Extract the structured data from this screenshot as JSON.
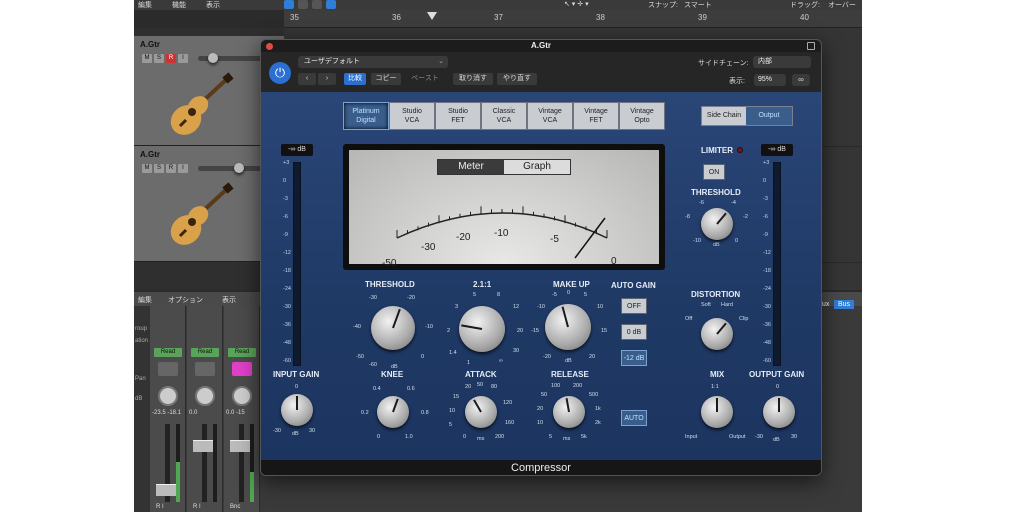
{
  "daw": {
    "top_left": "編集",
    "menu1": "機能",
    "menu2": "表示",
    "snap_label": "スナップ:",
    "snap_value": "スマート",
    "drag_label": "ドラッグ:",
    "drag_value": "オーバーラ",
    "ruler": [
      "35",
      "36",
      "37",
      "38",
      "39",
      "40"
    ],
    "tracks": [
      {
        "name": "A.Gtr",
        "m": "M",
        "s": "S",
        "r": "R",
        "i": "I"
      },
      {
        "name": "A.Gtr",
        "m": "M",
        "s": "S",
        "r": "R",
        "i": "I"
      }
    ],
    "mixer_menu": {
      "edit": "編集",
      "options": "オプション",
      "view": "表示"
    },
    "mixer_side": [
      "roup",
      "ation",
      "Pan",
      "dB"
    ],
    "strips": [
      {
        "read": "Read",
        "val": "-23.5  -18.1",
        "ri": "R I"
      },
      {
        "read": "Read",
        "val": "0.0",
        "ri": "R I"
      },
      {
        "read": "Read",
        "val": "0.0   -15",
        "ri": "Bnc"
      }
    ],
    "bus_labels": [
      "ux",
      "Bus"
    ]
  },
  "plugin": {
    "title": "A.Gtr",
    "preset": "ユーザデフォルト",
    "nav_prev": "‹",
    "nav_next": "›",
    "compare": "比較",
    "copy": "コピー",
    "paste": "ペースト",
    "undo": "取り消す",
    "redo": "やり直す",
    "sidechain_label": "サイドチェーン:",
    "sidechain_value": "内部",
    "zoom_label": "表示:",
    "zoom_value": "95%",
    "footer": "Compressor",
    "models": [
      {
        "line1": "Platinum",
        "line2": "Digital",
        "selected": true
      },
      {
        "line1": "Studio",
        "line2": "VCA",
        "selected": false
      },
      {
        "line1": "Studio",
        "line2": "FET",
        "selected": false
      },
      {
        "line1": "Classic",
        "line2": "VCA",
        "selected": false
      },
      {
        "line1": "Vintage",
        "line2": "VCA",
        "selected": false
      },
      {
        "line1": "Vintage",
        "line2": "FET",
        "selected": false
      },
      {
        "line1": "Vintage",
        "line2": "Opto",
        "selected": false
      }
    ],
    "side_chain_btn": "Side Chain",
    "output_btn": "Output",
    "input_db": "-∞ dB",
    "output_db": "-∞ dB",
    "meter_scale": [
      "+3",
      "0",
      "-3",
      "-6",
      "-9",
      "-12",
      "-18",
      "-24",
      "-30",
      "-36",
      "-48",
      "-60"
    ],
    "meter_tab_meter": "Meter",
    "meter_tab_graph": "Graph",
    "vu_scale": [
      "-50",
      "-30",
      "-20",
      "-10",
      "-5",
      "0"
    ],
    "threshold": {
      "label": "THRESHOLD",
      "ticks": [
        "-30",
        "-20",
        "-40",
        "-10",
        "-50",
        "0",
        "-60",
        "dB"
      ]
    },
    "ratio": {
      "label": "2.1:1",
      "ticks": [
        "5",
        "8",
        "3",
        "12",
        "2",
        "20",
        "1.4",
        "30",
        "1",
        "∞"
      ]
    },
    "makeup": {
      "label": "MAKE UP",
      "ticks": [
        "-5",
        "0",
        "5",
        "-10",
        "10",
        "-15",
        "15",
        "-20",
        "20",
        "dB"
      ]
    },
    "auto_gain_label": "AUTO GAIN",
    "auto_gain_off": "OFF",
    "auto_gain_0": "0 dB",
    "auto_gain_12": "-12 dB",
    "input_gain": {
      "label": "INPUT GAIN",
      "ticks": [
        "0",
        "-30",
        "30",
        "dB"
      ]
    },
    "knee": {
      "label": "KNEE",
      "ticks": [
        "0.4",
        "0.6",
        "0.2",
        "0.8",
        "0",
        "1.0"
      ]
    },
    "attack": {
      "label": "ATTACK",
      "ticks": [
        "20",
        "50",
        "80",
        "15",
        "120",
        "10",
        "5",
        "160",
        "0",
        "ms",
        "200"
      ]
    },
    "release": {
      "label": "RELEASE",
      "ticks": [
        "100",
        "200",
        "50",
        "500",
        "20",
        "1k",
        "10",
        "2k",
        "5",
        "ms",
        "5k"
      ]
    },
    "auto_btn": "AUTO",
    "limiter_label": "LIMITER",
    "limiter_on": "ON",
    "lim_threshold": {
      "label": "THRESHOLD",
      "ticks": [
        "-6",
        "-4",
        "-8",
        "-2",
        "-10",
        "0",
        "dB"
      ]
    },
    "distortion": {
      "label": "DISTORTION",
      "ticks": [
        "Soft",
        "Hard",
        "Off",
        "Clip"
      ]
    },
    "mix": {
      "label": "MIX",
      "ticks": [
        "1:1",
        "Input",
        "Output"
      ]
    },
    "output_gain": {
      "label": "OUTPUT GAIN",
      "ticks": [
        "0",
        "-30",
        "30",
        "dB"
      ]
    }
  }
}
